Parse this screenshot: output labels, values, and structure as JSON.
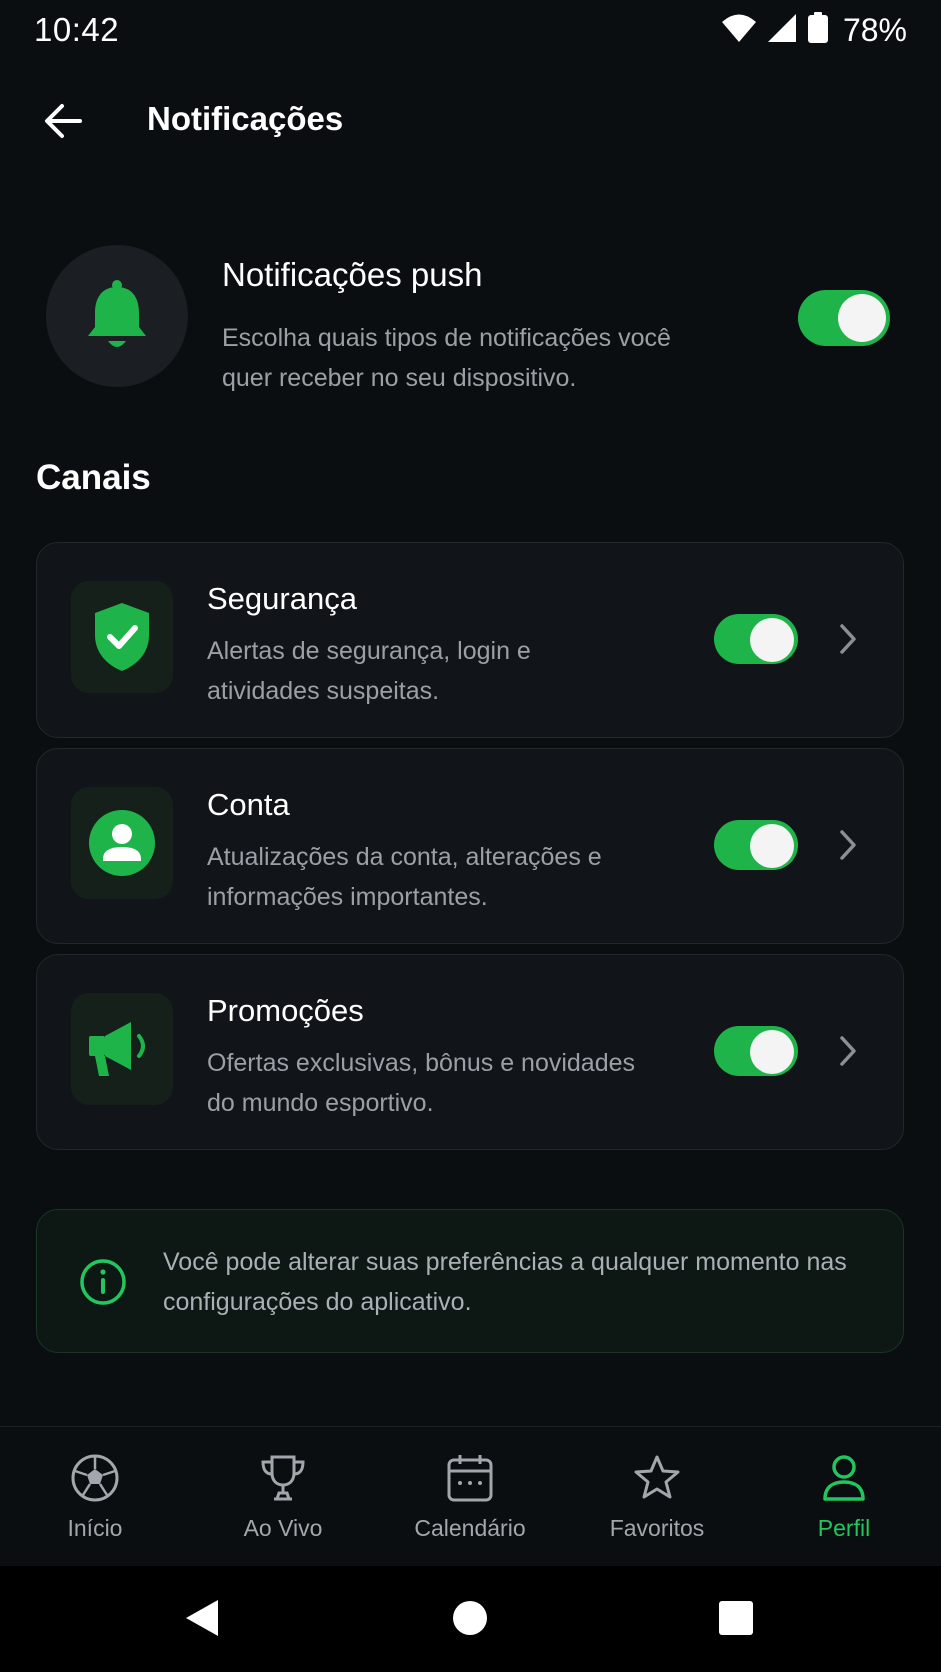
{
  "status_bar": {
    "time": "10:42",
    "battery": "78%",
    "icons": [
      "wifi-icon",
      "signal-icon",
      "battery-icon"
    ]
  },
  "header": {
    "title": "Notificações",
    "back_icon": "arrow-left-icon"
  },
  "push": {
    "title": "Notificações push",
    "description": "Escolha quais tipos de notificações você quer receber no seu dispositivo.",
    "icon": "bell-icon",
    "enabled": true
  },
  "channels": {
    "title": "Canais",
    "items": [
      {
        "title": "Segurança",
        "description": "Alertas de segurança, login e atividades suspeitas.",
        "icon": "shield-check-icon",
        "enabled": true
      },
      {
        "title": "Conta",
        "description": "Atualizações da conta, alterações e informações importantes.",
        "icon": "user-circle-icon",
        "enabled": true
      },
      {
        "title": "Promoções",
        "description": "Ofertas exclusivas, bônus e novidades do mundo esportivo.",
        "icon": "megaphone-icon",
        "enabled": true
      }
    ]
  },
  "info": {
    "text": "Você pode alterar suas preferências a qualquer momento nas configurações do aplicativo.",
    "icon": "info-icon"
  },
  "bottom_nav": {
    "items": [
      {
        "label": "Início",
        "icon": "soccer-ball-icon"
      },
      {
        "label": "Ao Vivo",
        "icon": "trophy-icon"
      },
      {
        "label": "Calendário",
        "icon": "calendar-icon"
      },
      {
        "label": "Favoritos",
        "icon": "star-icon"
      },
      {
        "label": "Perfil",
        "icon": "user-icon",
        "active": true
      }
    ]
  },
  "colors": {
    "accent": "#22c55e",
    "toggle_on": "#1fb44a",
    "background": "#0b0e11",
    "card": "#111519",
    "muted_text": "#9aa0a6"
  }
}
